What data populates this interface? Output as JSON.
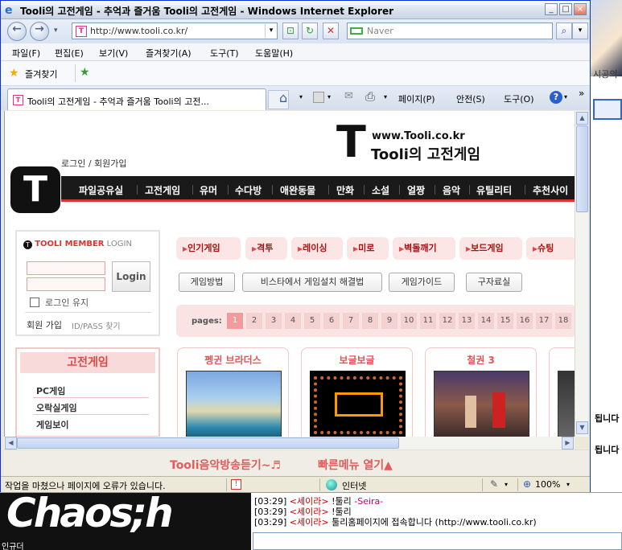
{
  "window": {
    "title": "Tooli의 고전게임 - 추억과 즐거움 Tooli의 고전게임 - Windows Internet Explorer",
    "address": "http://www.tooli.co.kr/",
    "search_placeholder": "Naver"
  },
  "menu": [
    "파일(F)",
    "편집(E)",
    "보기(V)",
    "즐겨찾기(A)",
    "도구(T)",
    "도움말(H)"
  ],
  "favorites_label": "즐겨찾기",
  "tab": {
    "title": "Tooli의 고전게임 - 추억과 즐거움 Tooli의 고전..."
  },
  "commands": {
    "page": "페이지(P)",
    "safety": "안전(S)",
    "tools": "도구(O)"
  },
  "site": {
    "url": "www.Tooli.co.kr",
    "name": "Tooli의 고전게임",
    "login_link": "로그인 / 회원가입",
    "categories": [
      "파일공유실",
      "고전게임",
      "유머",
      "수다방",
      "애완동물",
      "만화",
      "소설",
      "얼짱",
      "음악",
      "유틸리티",
      "추천사이"
    ],
    "member": {
      "header_brand": "TOOLI MEMBER",
      "header_login": "LOGIN",
      "login_button": "Login",
      "keep_login": "로그인 유지",
      "join": "회원 가입",
      "find": "ID/PASS 찾기"
    },
    "game_box": {
      "title": "고전게임",
      "items": [
        "PC게임",
        "오락실게임",
        "게임보이"
      ]
    },
    "genre_tags": [
      "인기게임",
      "격투",
      "레이싱",
      "미로",
      "벽돌깨기",
      "보드게임",
      "슈팅"
    ],
    "guide_buttons": [
      "게임방법",
      "비스타에서 게임설치 해결법",
      "게임가이드",
      "구자료실"
    ],
    "pages_label": "pages:",
    "pages": [
      "1",
      "2",
      "3",
      "4",
      "5",
      "6",
      "7",
      "8",
      "9",
      "10",
      "11",
      "12",
      "13",
      "14",
      "15",
      "16",
      "17",
      "18"
    ],
    "current_page": "1",
    "cards": [
      "펭귄 브라더스",
      "보글보글",
      "철권 3"
    ],
    "bottom_links": [
      "Tooli음악방송듣기~♬",
      "빠른메뉴 열기▲"
    ]
  },
  "status": {
    "text": "작업을 마쳤으나 페이지에 오류가 있습니다.",
    "zone": "인터넷",
    "zoom": "100%"
  },
  "background": {
    "right_text_1": "됩니다",
    "right_text_2": "됩니다",
    "right_top_fragment": "시공의",
    "chat_image_text": "Chaos;h",
    "chat_image_caption": "인규더",
    "chat_lines": [
      {
        "time": "[03:29]",
        "nick": "<세이라>",
        "msg": " !툴리 ",
        "extra": "-Seira-"
      },
      {
        "time": "[03:29]",
        "nick": "<세이라>",
        "msg": " !툴리",
        "extra": ""
      },
      {
        "time": "[03:29]",
        "nick": "<세이라>",
        "msg": " 툴리홈페이지에 접속합니다 (http://www.tooli.co.kr)",
        "extra": ""
      }
    ]
  },
  "colors": {
    "accent_red": "#e04848",
    "nav_black": "#1a1a1a",
    "ie_frame": "#0831d9"
  }
}
